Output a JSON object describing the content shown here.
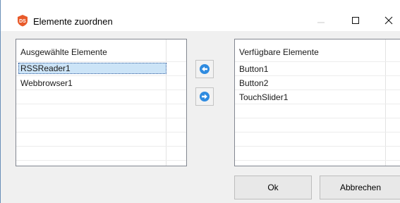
{
  "window": {
    "title": "Elemente zuordnen",
    "app_icon": "ds-app-icon",
    "controls": [
      "minimize-icon",
      "maximize-icon",
      "close-icon"
    ]
  },
  "left_list": {
    "header": "Ausgewählte Elemente",
    "items": [
      "RSSReader1",
      "Webbrowser1"
    ],
    "selected_index": 0
  },
  "right_list": {
    "header": "Verfügbare Elemente",
    "items": [
      "Button1",
      "Button2",
      "TouchSlider1"
    ]
  },
  "move_buttons": {
    "to_left_icon": "arrow-left-icon",
    "to_right_icon": "arrow-right-icon",
    "accent": "#2f8be0"
  },
  "buttons": {
    "ok": "Ok",
    "cancel": "Abbrechen"
  },
  "colors": {
    "selection": "#cce4f7",
    "app_icon": "#e85a2a"
  }
}
